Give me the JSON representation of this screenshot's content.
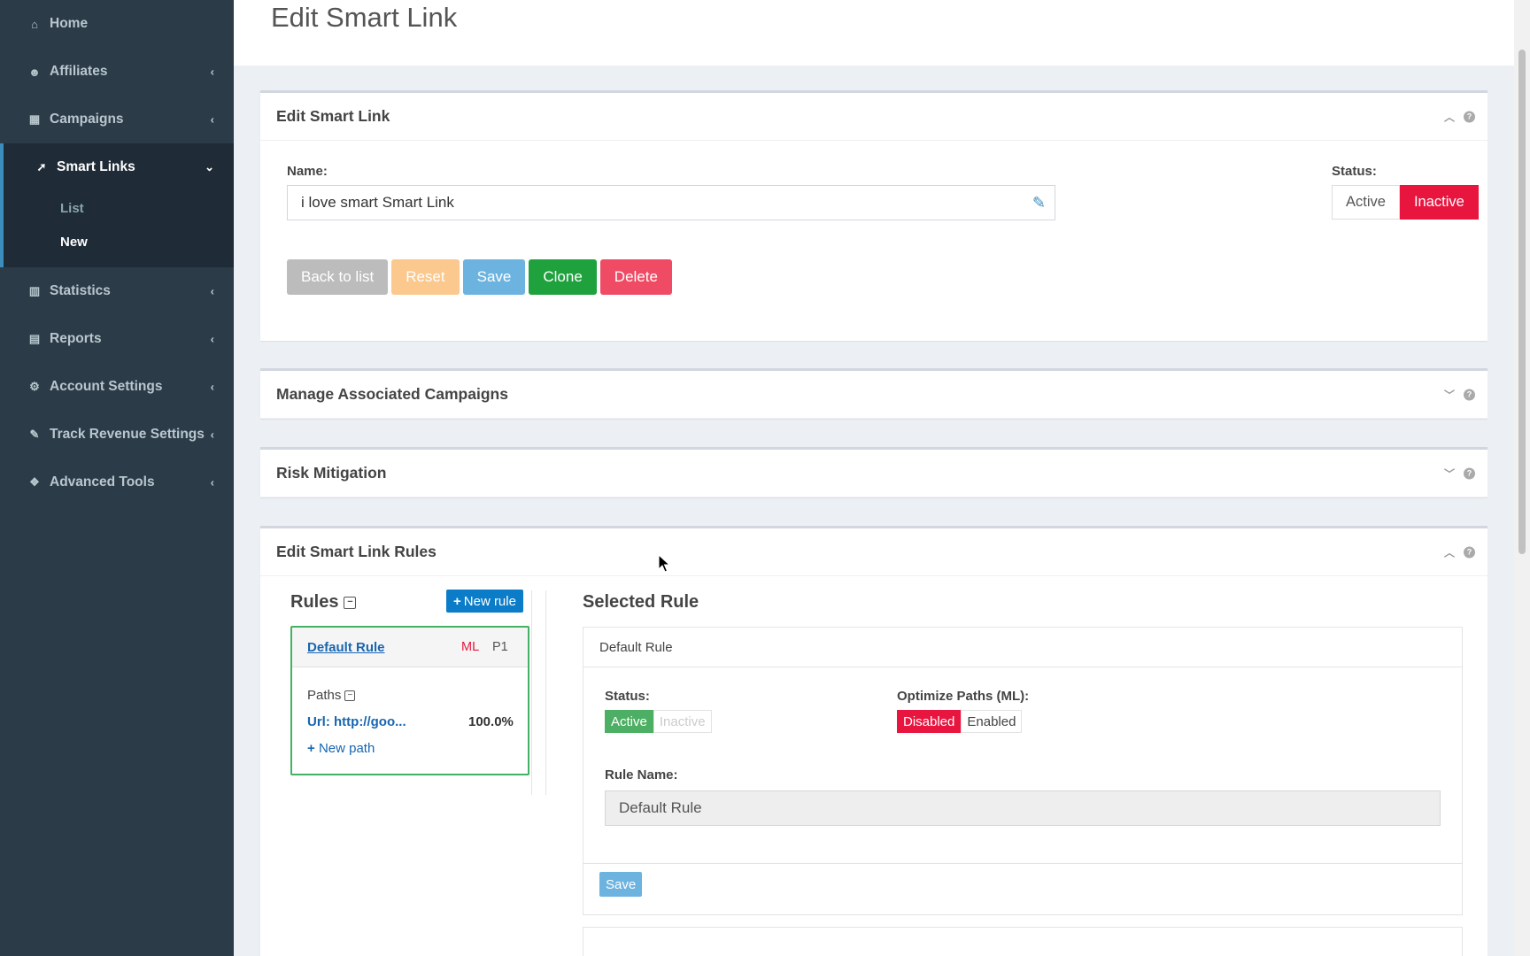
{
  "sidebar": {
    "items": [
      {
        "label": "Home",
        "icon": "home-icon",
        "glyph": "⌂"
      },
      {
        "label": "Affiliates",
        "icon": "users-icon",
        "glyph": "☻"
      },
      {
        "label": "Campaigns",
        "icon": "grid-icon",
        "glyph": "▦"
      },
      {
        "label": "Smart Links",
        "icon": "rocket-icon",
        "glyph": "➚"
      },
      {
        "label": "Statistics",
        "icon": "bar-chart-icon",
        "glyph": "▥"
      },
      {
        "label": "Reports",
        "icon": "file-icon",
        "glyph": "▤"
      },
      {
        "label": "Account Settings",
        "icon": "gear-icon",
        "glyph": "⚙"
      },
      {
        "label": "Track Revenue Settings",
        "icon": "wrench-icon",
        "glyph": "✎"
      },
      {
        "label": "Advanced Tools",
        "icon": "cubes-icon",
        "glyph": "❖"
      }
    ],
    "sub_items": [
      "List",
      "New"
    ]
  },
  "page": {
    "title": "Edit Smart Link"
  },
  "edit_panel": {
    "title": "Edit Smart Link",
    "name_label": "Name:",
    "name_value": "i love smart Smart Link",
    "status_label": "Status:",
    "status_active": "Active",
    "status_inactive": "Inactive",
    "buttons": {
      "back": "Back to list",
      "reset": "Reset",
      "save": "Save",
      "clone": "Clone",
      "delete": "Delete"
    }
  },
  "campaigns_panel": {
    "title": "Manage Associated Campaigns"
  },
  "risk_panel": {
    "title": "Risk Mitigation"
  },
  "rules_panel": {
    "title": "Edit Smart Link Rules",
    "rules_heading": "Rules",
    "new_rule": "New rule",
    "rule": {
      "name": "Default Rule",
      "ml_badge": "ML",
      "priority": "P1",
      "paths_label": "Paths",
      "path_url": "Url: http://goo...",
      "path_pct": "100.0%",
      "new_path": "New path"
    },
    "selected": {
      "heading": "Selected Rule",
      "box_title": "Default Rule",
      "status_label": "Status:",
      "status_active": "Active",
      "status_inactive": "Inactive",
      "optimize_label": "Optimize Paths (ML):",
      "opt_disabled": "Disabled",
      "opt_enabled": "Enabled",
      "rule_name_label": "Rule Name:",
      "rule_name_value": "Default Rule",
      "save": "Save"
    }
  },
  "colors": {
    "sidebar_bg": "#2c3b48",
    "accent_blue": "#3c8dbc",
    "danger_red": "#e8163f",
    "success_green": "#1fa13e"
  }
}
